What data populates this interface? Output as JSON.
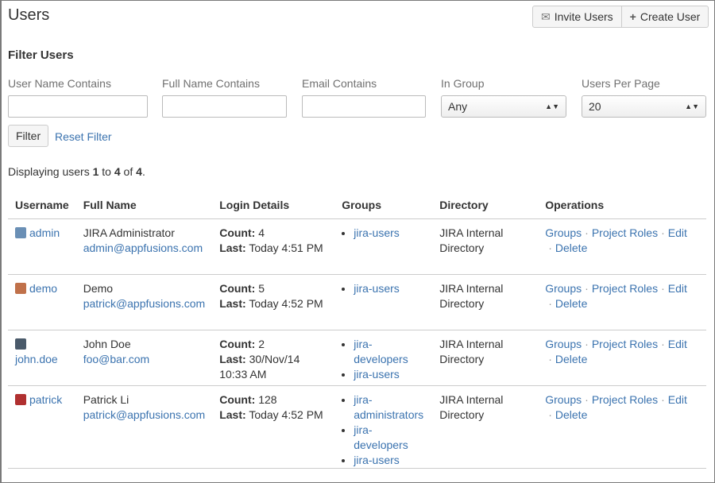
{
  "header": {
    "title": "Users",
    "invite_label": "Invite Users",
    "create_label": "Create User",
    "invite_icon": "envelope-icon",
    "create_icon": "plus-icon"
  },
  "filter": {
    "heading": "Filter Users",
    "fields": [
      {
        "label": "User Name Contains",
        "value": ""
      },
      {
        "label": "Full Name Contains",
        "value": ""
      },
      {
        "label": "Email Contains",
        "value": ""
      },
      {
        "label": "In Group",
        "selected": "Any"
      },
      {
        "label": "Users Per Page",
        "selected": "20"
      }
    ],
    "filter_label": "Filter",
    "reset_label": "Reset Filter"
  },
  "display": {
    "prefix": "Displaying users ",
    "from": "1",
    "to_word": " to ",
    "to": "4",
    "of_word": " of ",
    "total": "4",
    "suffix": "."
  },
  "table": {
    "headers": [
      "Username",
      "Full Name",
      "Login Details",
      "Groups",
      "Directory",
      "Operations"
    ],
    "count_label": "Count:",
    "last_label": "Last:",
    "ops": [
      "Groups",
      "Project Roles",
      "Edit",
      "Delete"
    ],
    "rows": [
      {
        "username": "admin",
        "full_name": "JIRA Administrator",
        "email": "admin@appfusions.com",
        "count": "4",
        "last": "Today 4:51 PM",
        "groups": [
          "jira-users"
        ],
        "directory": "JIRA Internal Directory",
        "avatar_color": "#6a8fb5"
      },
      {
        "username": "demo",
        "full_name": "Demo",
        "email": "patrick@appfusions.com",
        "count": "5",
        "last": "Today 4:52 PM",
        "groups": [
          "jira-users"
        ],
        "directory": "JIRA Internal Directory",
        "avatar_color": "#c0714a"
      },
      {
        "username": "john.doe",
        "full_name": "John Doe",
        "email": "foo@bar.com",
        "count": "2",
        "last": "30/Nov/14 10:33 AM",
        "groups": [
          "jira-developers",
          "jira-users"
        ],
        "directory": "JIRA Internal Directory",
        "avatar_color": "#4a5a6a"
      },
      {
        "username": "patrick",
        "full_name": "Patrick Li",
        "email": "patrick@appfusions.com",
        "count": "128",
        "last": "Today 4:52 PM",
        "groups": [
          "jira-administrators",
          "jira-developers",
          "jira-users"
        ],
        "directory": "JIRA Internal Directory",
        "avatar_color": "#b03030"
      }
    ]
  }
}
